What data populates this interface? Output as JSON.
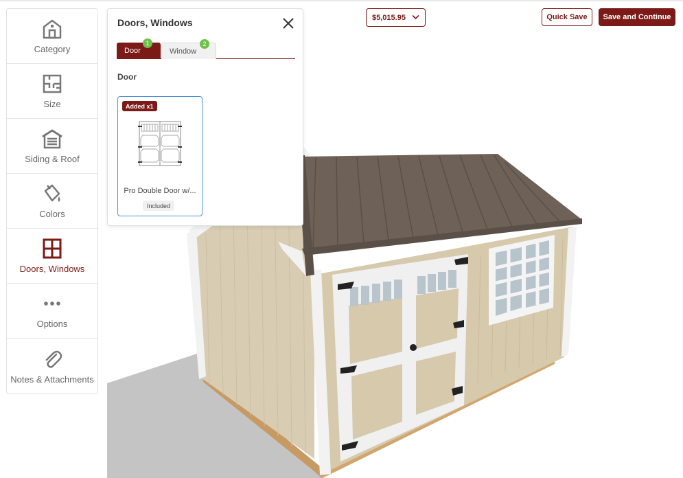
{
  "sidebar": {
    "items": [
      {
        "label": "Category",
        "icon": "barn-icon"
      },
      {
        "label": "Size",
        "icon": "floorplan-icon"
      },
      {
        "label": "Siding & Roof",
        "icon": "garage-icon"
      },
      {
        "label": "Colors",
        "icon": "paint-bucket-icon"
      },
      {
        "label": "Doors, Windows",
        "icon": "window-icon",
        "active": true
      },
      {
        "label": "Options",
        "icon": "more-dots-icon"
      },
      {
        "label": "Notes & Attachments",
        "icon": "paperclip-icon"
      }
    ]
  },
  "panel": {
    "title": "Doors, Windows",
    "tabs": [
      {
        "label": "Door",
        "count": "1"
      },
      {
        "label": "Window",
        "count": "2"
      }
    ],
    "section_label": "Door",
    "card": {
      "added_label": "Added x1",
      "name": "Pro Double Door w/...",
      "status": "Included"
    }
  },
  "toolbar": {
    "price": "$5,015.95",
    "quick_save_label": "Quick Save",
    "save_continue_label": "Save and Continue"
  },
  "colors": {
    "accent": "#7b1a17",
    "badge": "#6ec04a",
    "card_border": "#4a90d9"
  }
}
